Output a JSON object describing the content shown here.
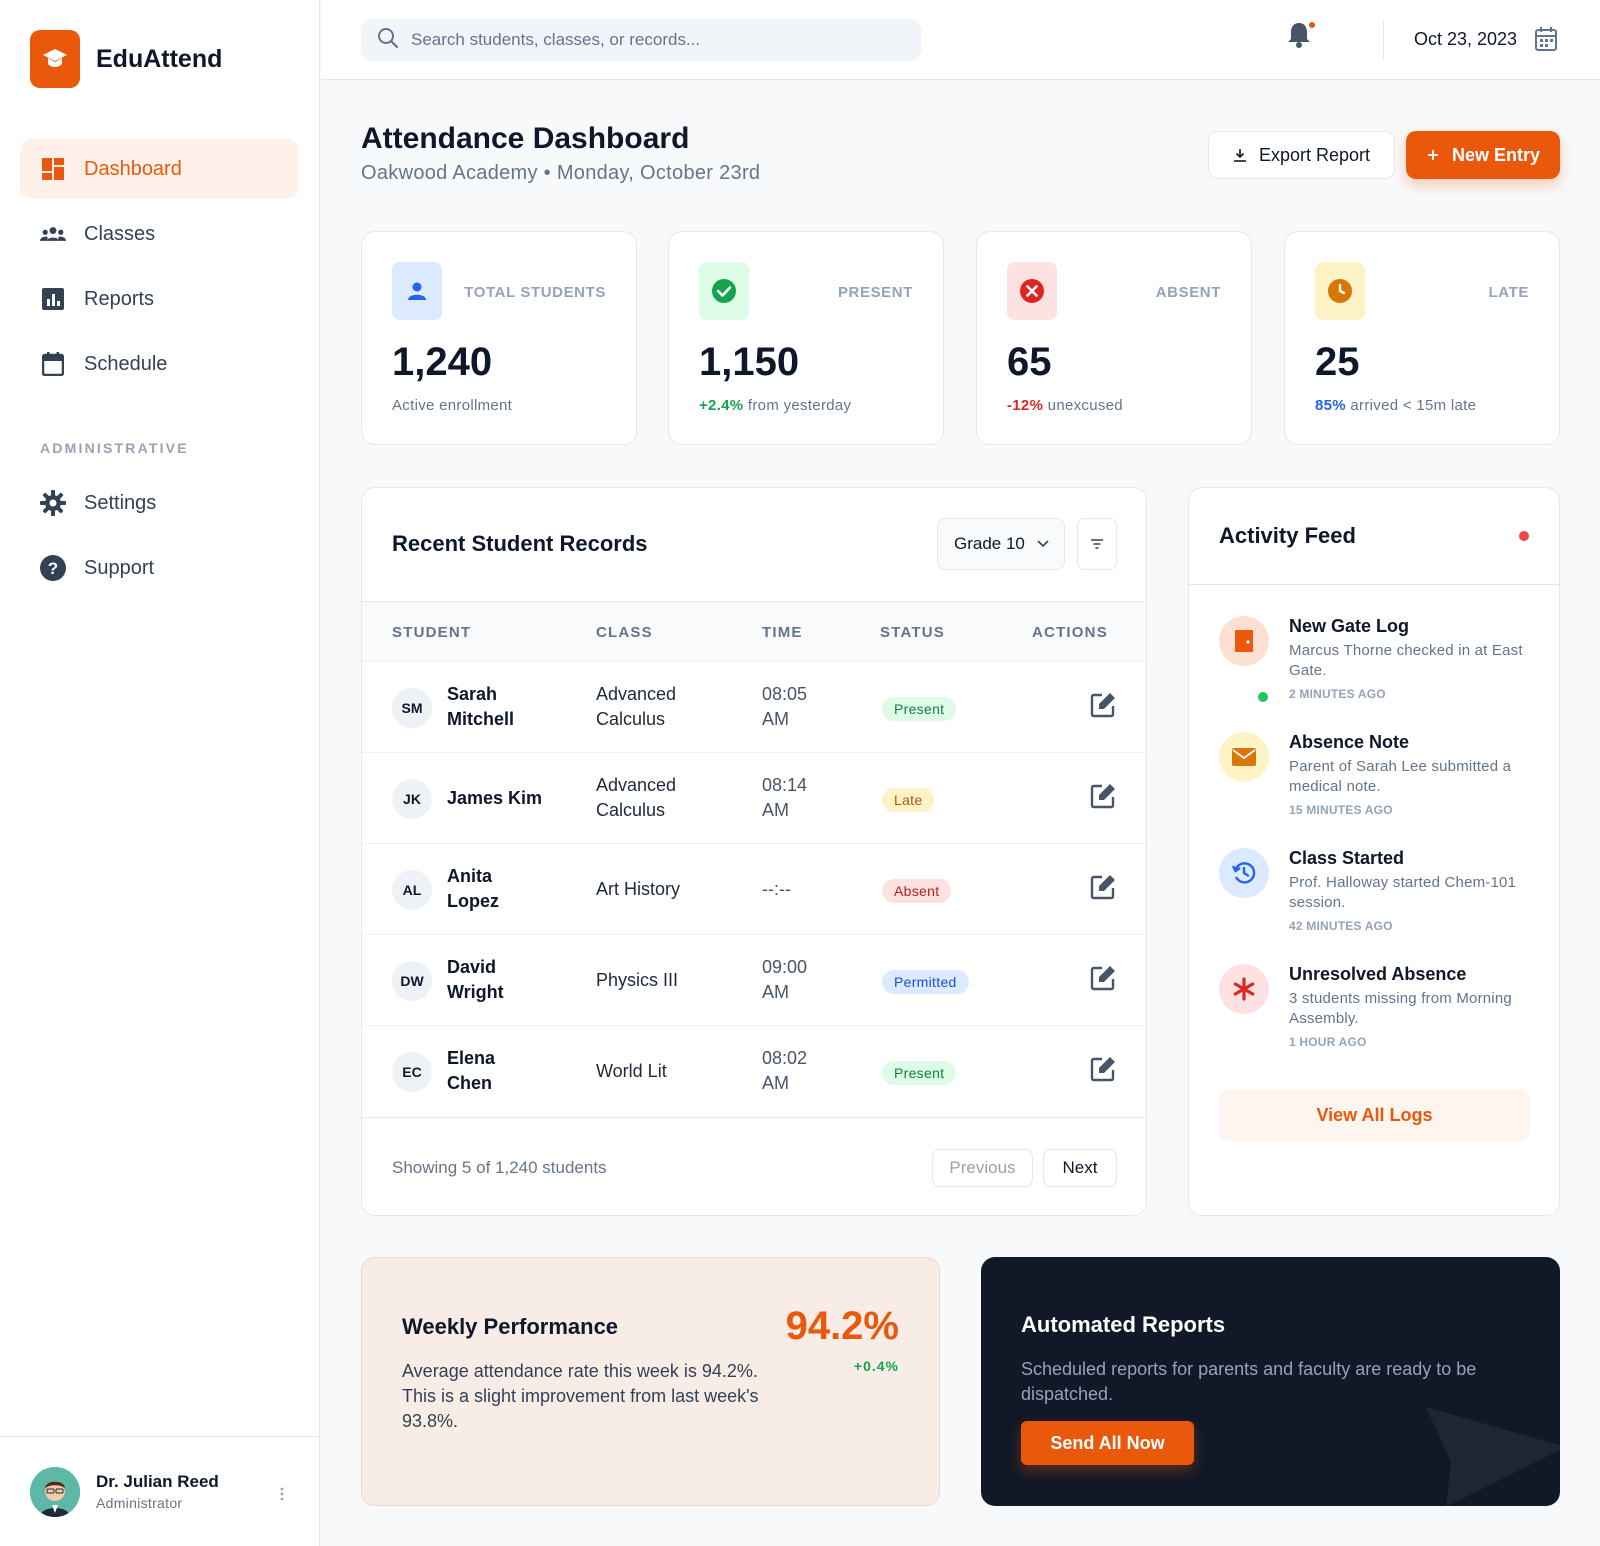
{
  "brand": {
    "name": "EduAttend",
    "logo_icon": "graduation-cap-icon",
    "color": "#ea580c"
  },
  "sidebar": {
    "items": [
      {
        "label": "Dashboard",
        "icon": "dashboard-icon",
        "active": true
      },
      {
        "label": "Classes",
        "icon": "users-icon"
      },
      {
        "label": "Reports",
        "icon": "chart-icon"
      },
      {
        "label": "Schedule",
        "icon": "calendar-icon"
      }
    ],
    "section_label": "ADMINISTRATIVE",
    "admin_items": [
      {
        "label": "Settings",
        "icon": "gear-icon"
      },
      {
        "label": "Support",
        "icon": "help-icon"
      }
    ],
    "user": {
      "name": "Dr. Julian Reed",
      "role": "Administrator"
    }
  },
  "topbar": {
    "search_placeholder": "Search students, classes, or records...",
    "date": "Oct 23, 2023"
  },
  "header": {
    "title": "Attendance Dashboard",
    "subtitle": "Oakwood Academy • Monday, October 23rd",
    "export_label": "Export Report",
    "new_label": "New Entry"
  },
  "stats": [
    {
      "label": "TOTAL STUDENTS",
      "value": "1,240",
      "highlight": "",
      "note": "Active enrollment",
      "icon": "user-icon"
    },
    {
      "label": "PRESENT",
      "value": "1,150",
      "highlight": "+2.4%",
      "note": " from yesterday",
      "icon": "check-circle-icon"
    },
    {
      "label": "ABSENT",
      "value": "65",
      "highlight": "-12%",
      "note": " unexcused",
      "icon": "x-circle-icon"
    },
    {
      "label": "LATE",
      "value": "25",
      "highlight": "85%",
      "note": " arrived < 15m late",
      "icon": "clock-icon"
    }
  ],
  "records": {
    "title": "Recent Student Records",
    "grade_filter": "Grade 10",
    "columns": [
      "STUDENT",
      "CLASS",
      "TIME",
      "STATUS",
      "ACTIONS"
    ],
    "rows": [
      {
        "initials": "SM",
        "name": "Sarah Mitchell",
        "class": "Advanced Calculus",
        "time": "08:05 AM",
        "status": "Present"
      },
      {
        "initials": "JK",
        "name": "James Kim",
        "class": "Advanced Calculus",
        "time": "08:14 AM",
        "status": "Late"
      },
      {
        "initials": "AL",
        "name": "Anita Lopez",
        "class": "Art History",
        "time": "--:--",
        "status": "Absent"
      },
      {
        "initials": "DW",
        "name": "David Wright",
        "class": "Physics III",
        "time": "09:00 AM",
        "status": "Permitted"
      },
      {
        "initials": "EC",
        "name": "Elena Chen",
        "class": "World Lit",
        "time": "08:02 AM",
        "status": "Present"
      }
    ],
    "showing": "Showing 5 of 1,240 students",
    "prev_label": "Previous",
    "next_label": "Next"
  },
  "feed": {
    "title": "Activity Feed",
    "items": [
      {
        "title": "New Gate Log",
        "desc": "Marcus Thorne checked in at East Gate.",
        "time": "2 MINUTES AGO",
        "icon": "door-icon"
      },
      {
        "title": "Absence Note",
        "desc": "Parent of Sarah Lee submitted a medical note.",
        "time": "15 MINUTES AGO",
        "icon": "mail-icon"
      },
      {
        "title": "Class Started",
        "desc": "Prof. Halloway started Chem-101 session.",
        "time": "42 MINUTES AGO",
        "icon": "history-icon"
      },
      {
        "title": "Unresolved Absence",
        "desc": "3 students missing from Morning Assembly.",
        "time": "1 HOUR AGO",
        "icon": "asterisk-icon"
      }
    ],
    "view_all_label": "View All Logs"
  },
  "weekly": {
    "title": "Weekly Performance",
    "desc": "Average attendance rate this week is 94.2%. This is a slight improvement from last week's 93.8%.",
    "value": "94.2%",
    "delta": "+0.4%"
  },
  "auto_reports": {
    "title": "Automated Reports",
    "desc": "Scheduled reports for parents and faculty are ready to be dispatched.",
    "button_label": "Send All Now"
  }
}
